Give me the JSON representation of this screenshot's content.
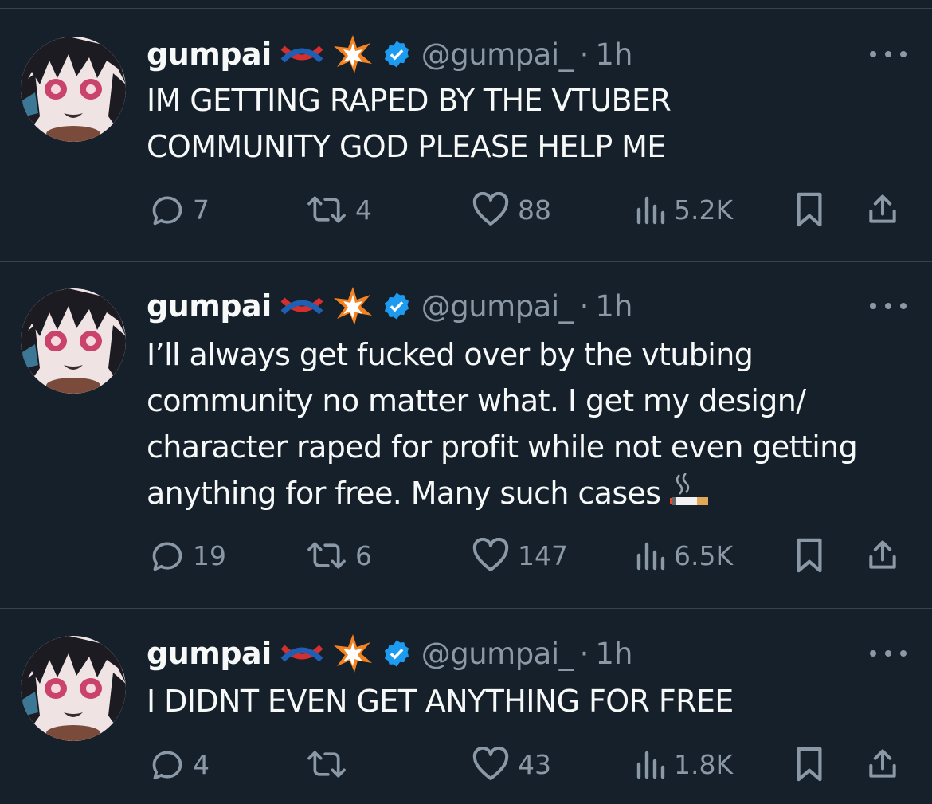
{
  "colors": {
    "background": "#15202b",
    "text": "#f7f9f9",
    "muted": "#8b98a5",
    "divider": "#38444d",
    "verified": "#1d9bf0"
  },
  "tweets": [
    {
      "name": "gumpai",
      "handle": "@gumpai_",
      "separator": "·",
      "time": "1h",
      "text": "IM GETTING RAPED BY THE VTUBER COMMUNITY GOD PLEASE HELP ME",
      "replies": "7",
      "retweets": "4",
      "likes": "88",
      "views": "5.2K"
    },
    {
      "name": "gumpai",
      "handle": "@gumpai_",
      "separator": "·",
      "time": "1h",
      "text": "I’ll always get fucked over by the vtubing community no matter what. I get my design/ character raped for profit while not even getting anything for free. Many such cases",
      "replies": "19",
      "retweets": "6",
      "likes": "147",
      "views": "6.5K"
    },
    {
      "name": "gumpai",
      "handle": "@gumpai_",
      "separator": "·",
      "time": "1h",
      "text": "I DIDNT EVEN GET ANYTHING FOR FREE",
      "replies": "4",
      "retweets": "",
      "likes": "43",
      "views": "1.8K"
    }
  ],
  "icons": {
    "reply": "reply-icon",
    "retweet": "retweet-icon",
    "like": "heart-icon",
    "views": "views-icon",
    "bookmark": "bookmark-icon",
    "share": "share-icon",
    "more": "more-icon",
    "verified": "verified-badge-icon",
    "knot": "knot-emoji",
    "collision": "collision-emoji",
    "cigarette": "cigarette-emoji"
  }
}
